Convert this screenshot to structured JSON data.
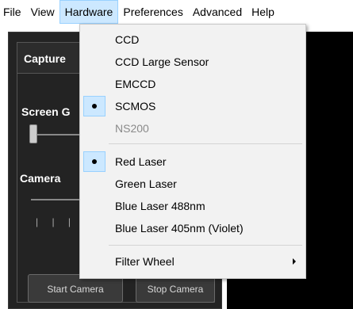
{
  "menubar": {
    "items": [
      "File",
      "View",
      "Hardware",
      "Preferences",
      "Advanced",
      "Help"
    ]
  },
  "panel": {
    "tab_label": "Capture",
    "screen_gain_label": "Screen G",
    "camera_label": "Camera",
    "ticks": "| | | |",
    "start_button": "Start Camera",
    "stop_button": "Stop Camera"
  },
  "hardware_menu": {
    "items": [
      {
        "label": "CCD",
        "checked": false,
        "disabled": false
      },
      {
        "label": "CCD Large Sensor",
        "checked": false,
        "disabled": false
      },
      {
        "label": "EMCCD",
        "checked": false,
        "disabled": false
      },
      {
        "label": "SCMOS",
        "checked": true,
        "disabled": false
      },
      {
        "label": "NS200",
        "checked": false,
        "disabled": true
      },
      {
        "label": "Red Laser",
        "checked": true,
        "disabled": false
      },
      {
        "label": "Green Laser",
        "checked": false,
        "disabled": false
      },
      {
        "label": "Blue Laser 488nm",
        "checked": false,
        "disabled": false
      },
      {
        "label": "Blue Laser 405nm (Violet)",
        "checked": false,
        "disabled": false
      },
      {
        "label": "Filter Wheel",
        "checked": false,
        "disabled": false,
        "submenu": true
      }
    ]
  },
  "colors": {
    "menu_highlight": "#cce8ff",
    "menu_highlight_border": "#99d1ff",
    "panel_bg": "#232323",
    "viewport_bg": "#000000"
  }
}
